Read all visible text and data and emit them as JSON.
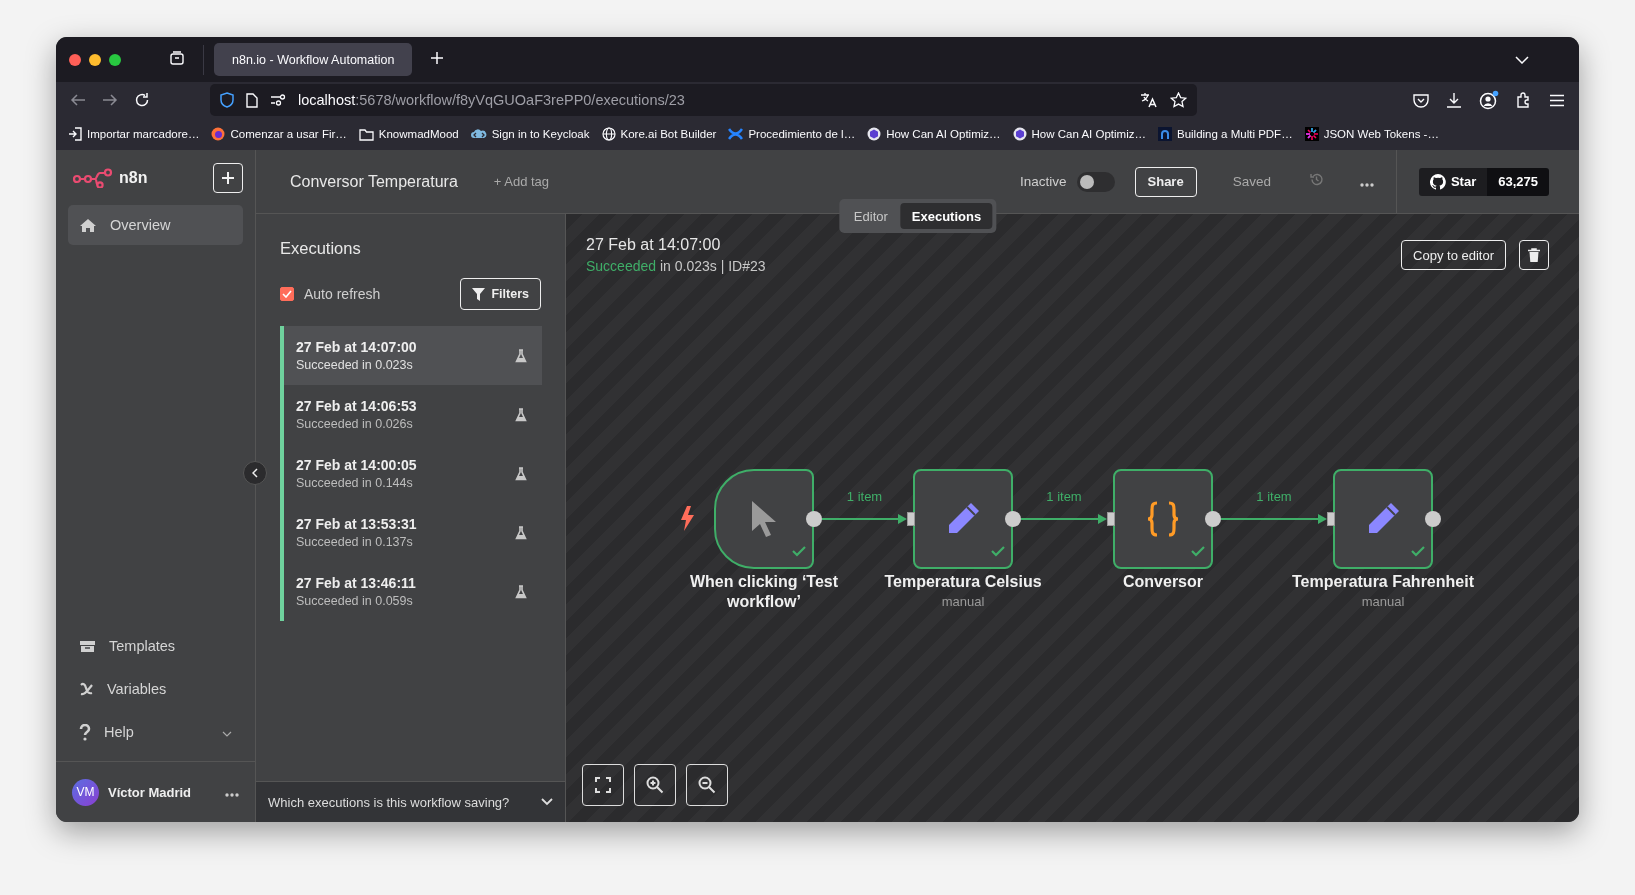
{
  "browser": {
    "tabs": [
      {
        "title": "n8n.io - Workflow Automation",
        "selected": true
      }
    ],
    "url": {
      "host": "localhost",
      "path": ":5678/workflow/f8yVqGUOaF3rePP0/executions/23"
    },
    "bookmarks": [
      {
        "label": "Importar marcadore…",
        "kind": "import"
      },
      {
        "label": "Comenzar a usar Fir…",
        "kind": "browser"
      },
      {
        "label": "KnowmadMood",
        "kind": "folder"
      },
      {
        "label": "Sign in to Keycloak",
        "kind": "keycloak"
      },
      {
        "label": "Kore.ai Bot Builder",
        "kind": "globe"
      },
      {
        "label": "Procedimiento de l…",
        "kind": "cross"
      },
      {
        "label": "How Can AI Optimiz…",
        "kind": "hexagon"
      },
      {
        "label": "How Can AI Optimiz…",
        "kind": "hexagon"
      },
      {
        "label": "Building a Multi PDF…",
        "kind": "arch"
      },
      {
        "label": "JSON Web Tokens -…",
        "kind": "burst"
      }
    ]
  },
  "sidebar": {
    "logo": "n8n",
    "items": [
      {
        "label": "Overview",
        "kind": "home",
        "selected": true
      }
    ],
    "bottom_items": [
      {
        "label": "Templates",
        "kind": "templates",
        "selected": false,
        "expandable": false
      },
      {
        "label": "Variables",
        "kind": "variables",
        "selected": false,
        "expandable": false
      },
      {
        "label": "Help",
        "kind": "help",
        "selected": false,
        "expandable": true
      }
    ],
    "user": {
      "initials": "VM",
      "name": "Víctor Madrid"
    }
  },
  "header": {
    "workflow_name": "Conversor Temperatura",
    "add_tag": "+ Add tag",
    "active_label": "Inactive",
    "active": false,
    "share": "Share",
    "save_status": "Saved",
    "star": "Star",
    "star_count": "63,275"
  },
  "view_tabs": [
    {
      "label": "Editor",
      "selected": false
    },
    {
      "label": "Executions",
      "selected": true
    }
  ],
  "executions": {
    "title": "Executions",
    "auto_refresh": {
      "label": "Auto refresh",
      "checked": true
    },
    "filters": "Filters",
    "items": [
      {
        "time": "27 Feb at 14:07:00",
        "status": "Succeeded in 0.023s",
        "succeeded": true,
        "selected": true
      },
      {
        "time": "27 Feb at 14:06:53",
        "status": "Succeeded in 0.026s",
        "succeeded": true,
        "selected": false
      },
      {
        "time": "27 Feb at 14:00:05",
        "status": "Succeeded in 0.144s",
        "succeeded": true,
        "selected": false
      },
      {
        "time": "27 Feb at 13:53:31",
        "status": "Succeeded in 0.137s",
        "succeeded": true,
        "selected": false
      },
      {
        "time": "27 Feb at 13:46:11",
        "status": "Succeeded in 0.059s",
        "succeeded": true,
        "selected": false
      }
    ],
    "saving_question": "Which executions is this workflow saving?"
  },
  "execution": {
    "time": "27 Feb at 14:07:00",
    "status": "Succeeded",
    "succeeded": true,
    "details": "in 0.023s | ID#23",
    "copy_button": "Copy to editor"
  },
  "nodes": [
    {
      "name": "When clicking ‘Test workflow’",
      "kind": "trigger",
      "succeeded": true
    },
    {
      "name": "Temperatura Celsius",
      "subtitle": "manual",
      "kind": "set",
      "succeeded": true
    },
    {
      "name": "Conversor",
      "kind": "code",
      "succeeded": true
    },
    {
      "name": "Temperatura Fahrenheit",
      "subtitle": "manual",
      "kind": "set",
      "succeeded": true
    }
  ],
  "connections": [
    {
      "label": "1 item"
    },
    {
      "label": "1 item"
    },
    {
      "label": "1 item"
    }
  ]
}
